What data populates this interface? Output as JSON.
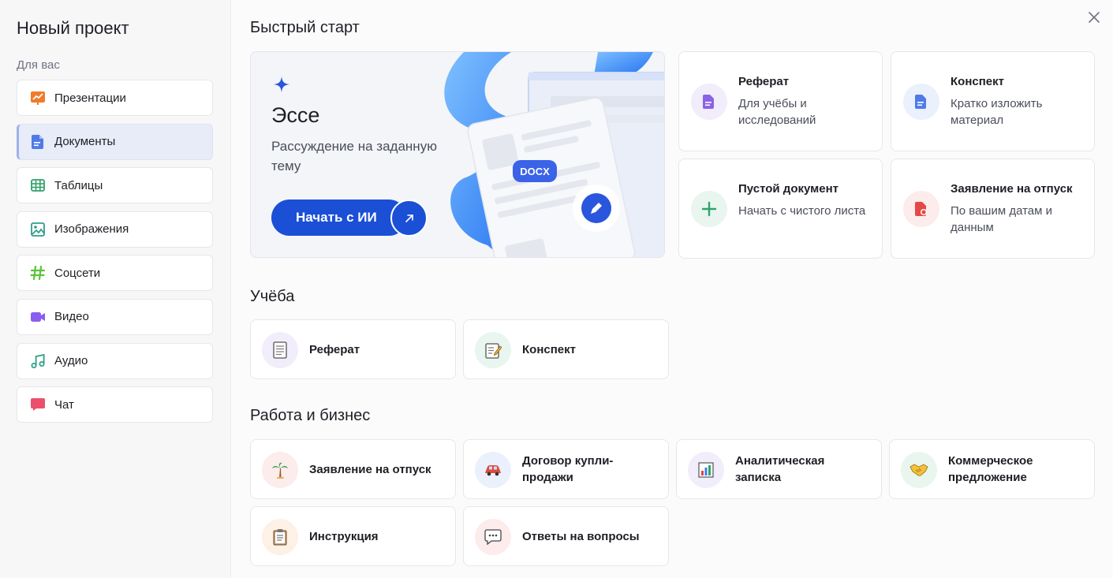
{
  "sidebar": {
    "title": "Новый проект",
    "section": "Для вас",
    "items": [
      {
        "label": "Презентации",
        "icon": "presentation-icon",
        "active": false
      },
      {
        "label": "Документы",
        "icon": "document-icon",
        "active": true
      },
      {
        "label": "Таблицы",
        "icon": "table-icon",
        "active": false
      },
      {
        "label": "Изображения",
        "icon": "image-icon",
        "active": false
      },
      {
        "label": "Соцсети",
        "icon": "hashtag-icon",
        "active": false
      },
      {
        "label": "Видео",
        "icon": "video-icon",
        "active": false
      },
      {
        "label": "Аудио",
        "icon": "music-note-icon",
        "active": false
      },
      {
        "label": "Чат",
        "icon": "chat-icon",
        "active": false
      }
    ]
  },
  "main": {
    "quick_start": {
      "title": "Быстрый старт",
      "hero": {
        "title": "Эссе",
        "subtitle": "Рассуждение на заданную тему",
        "button": "Начать с ИИ",
        "badge": "DOCX"
      },
      "cards": [
        {
          "title": "Реферат",
          "desc": "Для учёбы и исследований",
          "icon": "document-icon",
          "bg": "#f1edfb"
        },
        {
          "title": "Конспект",
          "desc": "Кратко изложить материал",
          "icon": "document-icon",
          "bg": "#eaf0fc"
        },
        {
          "title": "Пустой документ",
          "desc": "Начать с чистого листа",
          "icon": "plus-icon",
          "bg": "#e8f6ef"
        },
        {
          "title": "Заявление на отпуск",
          "desc": "По вашим датам и данным",
          "icon": "leave-request-icon",
          "bg": "#fdecec"
        }
      ]
    },
    "study": {
      "title": "Учёба",
      "items": [
        {
          "title": "Реферат",
          "icon": "page-icon",
          "bg": "#f1edfb"
        },
        {
          "title": "Конспект",
          "icon": "memo-icon",
          "bg": "#e8f6ef"
        }
      ]
    },
    "work": {
      "title": "Работа и бизнес",
      "items": [
        {
          "title": "Заявление на отпуск",
          "icon": "palm-tree-icon",
          "bg": "#fdecec"
        },
        {
          "title": "Договор купли-продажи",
          "icon": "car-icon",
          "bg": "#eaf0fc"
        },
        {
          "title": "Аналитическая записка",
          "icon": "bar-chart-icon",
          "bg": "#f1edfb"
        },
        {
          "title": "Коммерческое предложение",
          "icon": "handshake-icon",
          "bg": "#e8f6ef"
        },
        {
          "title": "Инструкция",
          "icon": "clipboard-icon",
          "bg": "#fdf1e6"
        },
        {
          "title": "Ответы на вопросы",
          "icon": "speech-bubble-icon",
          "bg": "#fdecec"
        }
      ]
    }
  },
  "colors": {
    "accent": "#1a4fd6",
    "active_item": "#e7ecf8"
  }
}
